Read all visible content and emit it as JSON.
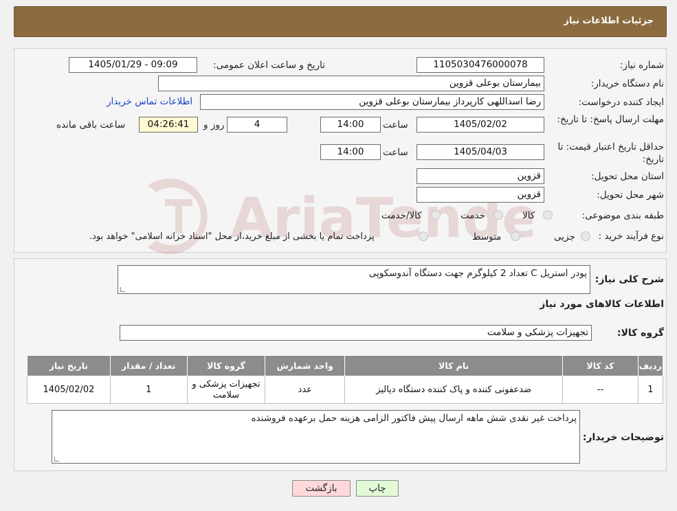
{
  "header": {
    "title": "جزئیات اطلاعات نیاز"
  },
  "form": {
    "need_number_label": "شماره نیاز:",
    "need_number": "1105030476000078",
    "announce_label": "تاریخ و ساعت اعلان عمومی:",
    "announce_value": "1405/01/29 - 09:09",
    "buyer_org_label": "نام دستگاه خریدار:",
    "buyer_org": "بیمارستان بوعلی قزوین",
    "creator_label": "ایجاد کننده درخواست:",
    "creator": "رضا اسداللهی کارپرداز بیمارستان بوعلی قزوین",
    "contact_link": "اطلاعات تماس خریدار",
    "deadline_label": "مهلت ارسال پاسخ: تا تاریخ:",
    "deadline_date": "1405/02/02",
    "time_label": "ساعت",
    "deadline_time": "14:00",
    "days_value": "4",
    "days_label": "روز و",
    "remaining_time": "04:26:41",
    "remaining_label": "ساعت باقی مانده",
    "validity_label": "حداقل تاریخ اعتبار قیمت: تا تاریخ:",
    "validity_date": "1405/04/03",
    "validity_time": "14:00",
    "province_label": "استان محل تحویل:",
    "province": "قزوین",
    "city_label": "شهر محل تحویل:",
    "city": "قزوین",
    "category_label": "طبقه بندی موضوعی:",
    "category_options": [
      "کالا",
      "خدمت",
      "کالا/خدمت"
    ],
    "process_label": "نوع فرآیند خرید :",
    "process_options": [
      "جزیی",
      "متوسط"
    ],
    "process_note": "پرداخت تمام یا بخشی از مبلغ خرید،از محل \"اسناد خزانه اسلامی\" خواهد بود."
  },
  "description": {
    "label": "شرح کلی نیاز:",
    "value": "پودر استریل C تعداد 2 کیلوگرم  جهت دستگاه آندوسکوپی"
  },
  "goods": {
    "section_title": "اطلاعات کالاهای مورد نیاز",
    "group_label": "گروه کالا:",
    "group_value": "تجهیزات پزشکی و سلامت",
    "columns": [
      "ردیف",
      "کد کالا",
      "نام کالا",
      "واحد شمارش",
      "گروه کالا",
      "تعداد / مقدار",
      "تاریخ نیاز"
    ],
    "rows": [
      [
        "1",
        "--",
        "ضدعفونی کننده و پاک کننده دستگاه دیالیز",
        "عدد",
        "تجهیزات پزشکی و سلامت",
        "1",
        "1405/02/02"
      ]
    ]
  },
  "buyer_notes": {
    "label": "توضیحات خریدار:",
    "value": "پرداخت غیر نقدی شش ماهه ارسال پیش فاکتور الزامی هزینه حمل برعهده فروشنده"
  },
  "buttons": {
    "print": "چاپ",
    "back": "بازگشت"
  },
  "watermark": {
    "text": "AriaTender.neT"
  },
  "colors": {
    "header": "#8c6c3f",
    "table_header": "#8c8c8c",
    "link": "#1b45c9",
    "back_button": "#ffd9d9",
    "print_button": "#e2fbd6"
  }
}
